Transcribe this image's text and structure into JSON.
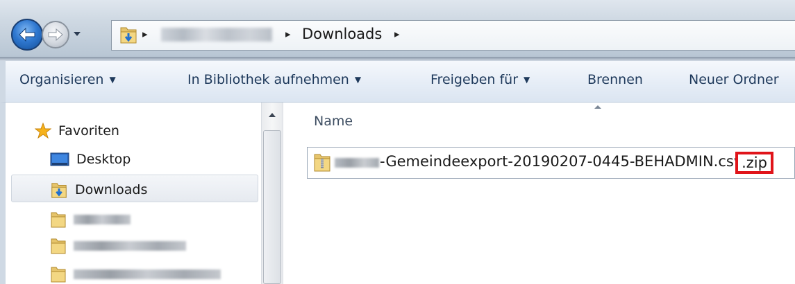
{
  "window": {
    "address_bar": {
      "breadcrumbs": [
        "Downloads"
      ],
      "breadcrumb_separator": "▸",
      "back_icon": "back-arrow-icon",
      "forward_icon": "forward-arrow-icon",
      "recent_icon": "chevron-down-icon",
      "folder_icon": "downloads-folder-icon"
    },
    "toolbar": {
      "items": [
        {
          "label": "Organisieren",
          "has_dropdown": true
        },
        {
          "label": "In Bibliothek aufnehmen",
          "has_dropdown": true
        },
        {
          "label": "Freigeben für",
          "has_dropdown": true
        },
        {
          "label": "Brennen",
          "has_dropdown": false
        },
        {
          "label": "Neuer Ordner",
          "has_dropdown": false
        }
      ],
      "dropdown_glyph": "▼"
    },
    "navigation_pane": {
      "favorites_label": "Favoriten",
      "items": [
        {
          "label": "Desktop",
          "icon": "desktop-icon"
        },
        {
          "label": "Downloads",
          "icon": "downloads-folder-icon",
          "selected": true
        }
      ]
    },
    "file_list": {
      "column_header": "Name",
      "files": [
        {
          "name_visible": "-Gemeindeexport-20190207-0445-BEHADMIN.csv",
          "extension_highlight": ".zip",
          "icon": "zip-folder-icon"
        }
      ]
    },
    "colors": {
      "accent_blue": "#2f78d0",
      "highlight_red": "#e0141a",
      "toolbar_text": "#1e395b"
    }
  }
}
